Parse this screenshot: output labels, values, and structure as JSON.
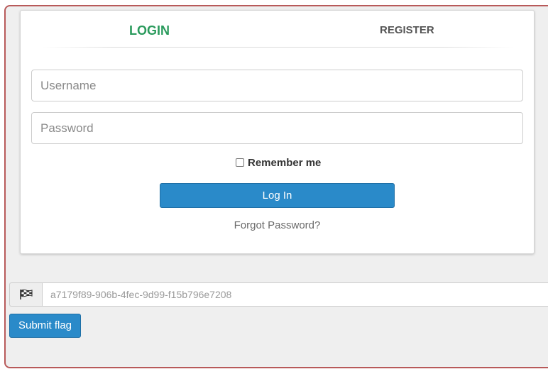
{
  "tabs": {
    "login": "LOGIN",
    "register": "REGISTER"
  },
  "form": {
    "username_placeholder": "Username",
    "password_placeholder": "Password",
    "remember_label": "Remember me",
    "remember_checked": false,
    "login_button": "Log In",
    "forgot_link": "Forgot Password?"
  },
  "flag": {
    "icon": "checkered-flag-icon",
    "placeholder": "a7179f89-906b-4fec-9d99-f15b796e7208",
    "submit_label": "Submit flag"
  },
  "colors": {
    "active_tab": "#2a9a5c",
    "primary_button": "#2a8ac9",
    "frame_border": "#b85a5a"
  }
}
